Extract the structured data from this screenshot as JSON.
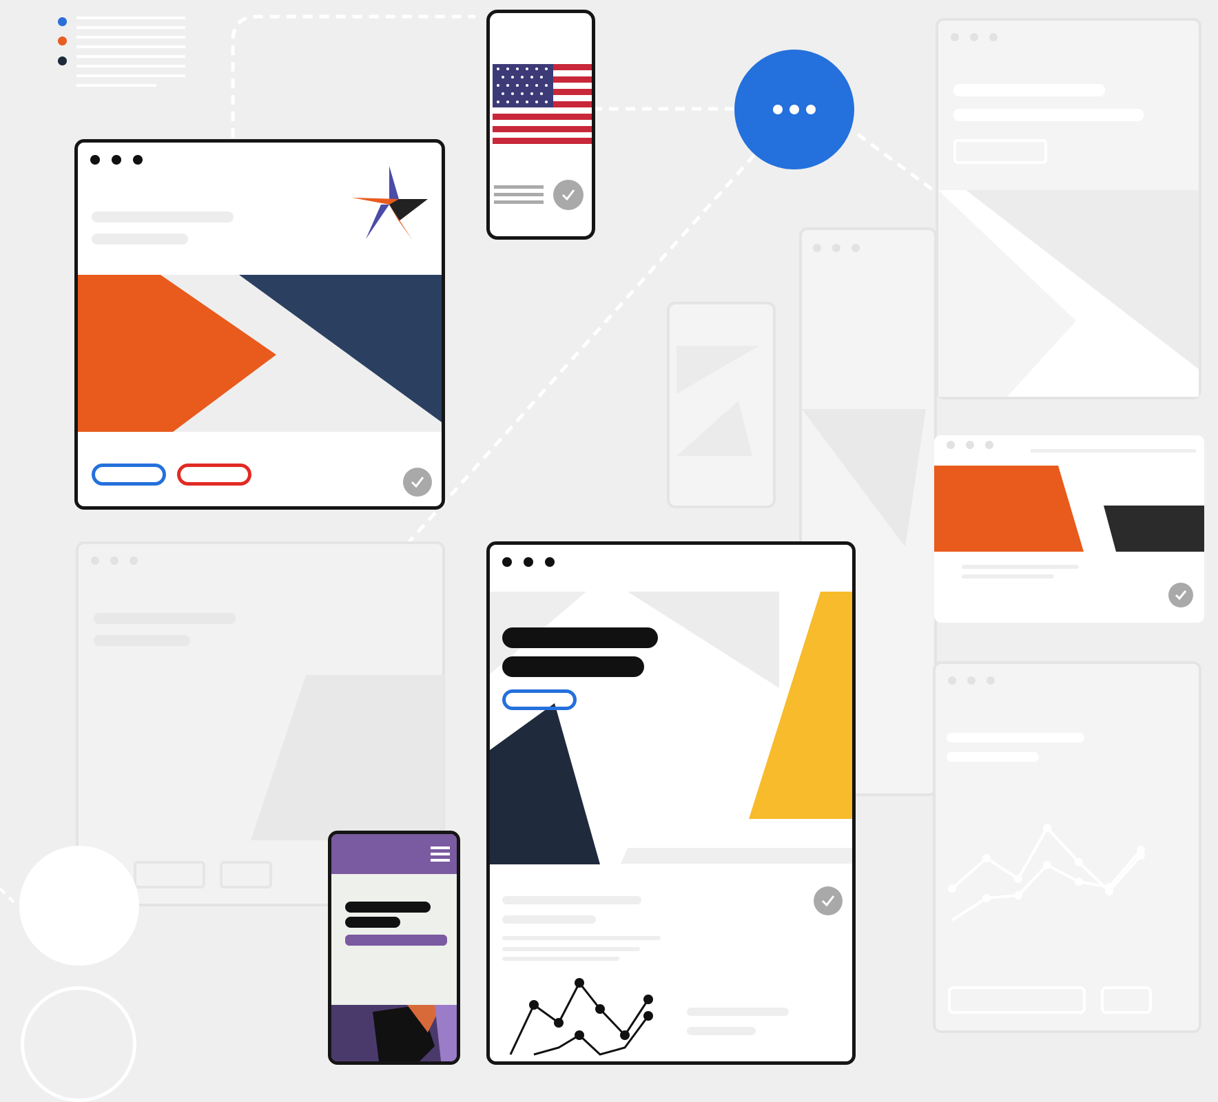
{
  "scene": "responsive-multi-device-illustration",
  "legend_dot_colors": [
    "#2b6fd8",
    "#e85d24",
    "#1c2a3a"
  ],
  "colors": {
    "background": "#efefef",
    "orange": "#e85b1c",
    "navy": "#2b4061",
    "dark_navy": "#1f2a3d",
    "yellow": "#f7bb2c",
    "blue": "#2470dc",
    "red": "#e02b24",
    "purple": "#7a5aa0",
    "check_gray": "#a9a9a9"
  },
  "icons": {
    "more_button": "more-horizontal-icon",
    "check": "check-circle-icon",
    "menu": "hamburger-menu-icon",
    "star": "star-logo-icon",
    "flag": "us-flag-icon"
  }
}
